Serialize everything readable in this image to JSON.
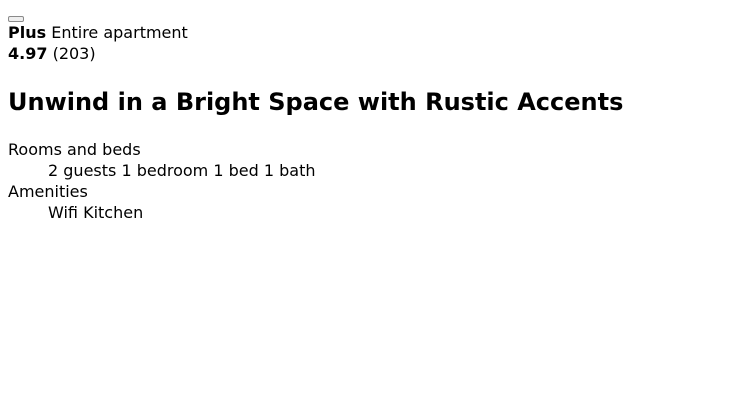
{
  "listing": {
    "badge": "Plus",
    "type": "Entire apartment",
    "rating": "4.97",
    "reviews": "(203)",
    "title": "Unwind in a Bright Space with Rustic Accents"
  },
  "details": {
    "rooms_label": "Rooms and beds",
    "rooms": [
      "2 guests",
      "1 bedroom",
      "1 bed",
      "1 bath"
    ],
    "amenities_label": "Amenities",
    "amenities": [
      "Wifi",
      "Kitchen"
    ]
  }
}
